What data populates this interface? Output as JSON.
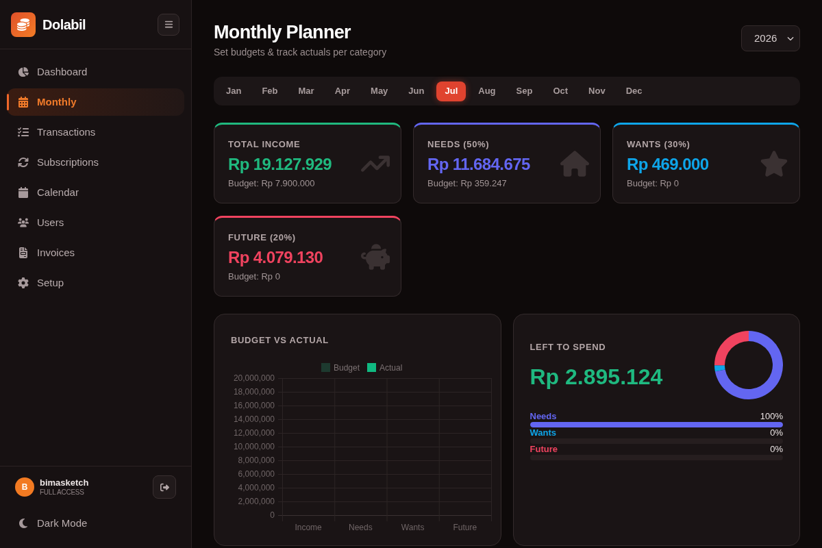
{
  "sidebar": {
    "brand": "Dolabil",
    "items": [
      {
        "label": "Dashboard",
        "selected": false
      },
      {
        "label": "Monthly",
        "selected": true
      },
      {
        "label": "Transactions",
        "selected": false
      },
      {
        "label": "Subscriptions",
        "selected": false
      },
      {
        "label": "Calendar",
        "selected": false
      },
      {
        "label": "Users",
        "selected": false
      },
      {
        "label": "Invoices",
        "selected": false
      },
      {
        "label": "Setup",
        "selected": false
      }
    ],
    "user": {
      "initial": "B",
      "name": "bimasketch",
      "role": "FULL ACCESS"
    },
    "theme_toggle": {
      "label": "Dark Mode"
    }
  },
  "header": {
    "title": "Monthly Planner",
    "subtitle": "Set budgets & track actuals per category",
    "year": "2026"
  },
  "months": [
    {
      "label": "Jan",
      "selected": false
    },
    {
      "label": "Feb",
      "selected": false
    },
    {
      "label": "Mar",
      "selected": false
    },
    {
      "label": "Apr",
      "selected": false
    },
    {
      "label": "May",
      "selected": false
    },
    {
      "label": "Jun",
      "selected": false
    },
    {
      "label": "Jul",
      "selected": true
    },
    {
      "label": "Aug",
      "selected": false
    },
    {
      "label": "Sep",
      "selected": false
    },
    {
      "label": "Oct",
      "selected": false
    },
    {
      "label": "Nov",
      "selected": false
    },
    {
      "label": "Dec",
      "selected": false
    }
  ],
  "summary_cards": [
    {
      "label": "TOTAL INCOME",
      "value": "Rp 19.127.929",
      "budget": "Budget: Rp 7.900.000",
      "color": "#20b97f"
    },
    {
      "label": "NEEDS (50%)",
      "value": "Rp 11.684.675",
      "budget": "Budget: Rp 359.247",
      "color": "#6366f1"
    },
    {
      "label": "WANTS (30%)",
      "value": "Rp 469.000",
      "budget": "Budget: Rp 0",
      "color": "#0ea5e9"
    },
    {
      "label": "FUTURE (20%)",
      "value": "Rp 4.079.130",
      "budget": "Budget: Rp 0",
      "color": "#f0435f"
    }
  ],
  "budget_chart": {
    "chart_data": {
      "type": "bar",
      "title": "BUDGET VS ACTUAL",
      "categories": [
        "Income",
        "Needs",
        "Wants",
        "Future"
      ],
      "series": [
        {
          "name": "Budget",
          "color": "#1d3a2f",
          "values": [
            0,
            0,
            0,
            0
          ]
        },
        {
          "name": "Actual",
          "color": "#10b981",
          "values": [
            0,
            0,
            0,
            0
          ]
        }
      ],
      "ylim": [
        0,
        20000000
      ],
      "yticks": [
        {
          "value": 20000000,
          "label": "20,000,000"
        },
        {
          "value": 18000000,
          "label": "18,000,000"
        },
        {
          "value": 16000000,
          "label": "16,000,000"
        },
        {
          "value": 14000000,
          "label": "14,000,000"
        },
        {
          "value": 12000000,
          "label": "12,000,000"
        },
        {
          "value": 10000000,
          "label": "10,000,000"
        },
        {
          "value": 8000000,
          "label": "8,000,000"
        },
        {
          "value": 6000000,
          "label": "6,000,000"
        },
        {
          "value": 4000000,
          "label": "4,000,000"
        },
        {
          "value": 2000000,
          "label": "2,000,000"
        },
        {
          "value": 0,
          "label": "0"
        }
      ],
      "grid": true
    }
  },
  "left_to_spend": {
    "label": "LEFT TO SPEND",
    "value": "Rp 2.895.124",
    "chart_data": {
      "type": "donut",
      "categories": [
        "Needs",
        "Wants",
        "Future"
      ],
      "values": [
        72.0,
        2.9,
        25.1
      ]
    },
    "breakdown": [
      {
        "percent": "100%",
        "level": 1,
        "color": "#6366f1"
      },
      {
        "percent": "0%",
        "level": 0,
        "color": "#0ea5e9"
      },
      {
        "percent": "0%",
        "level": 0,
        "color": "#f0435f"
      }
    ]
  }
}
